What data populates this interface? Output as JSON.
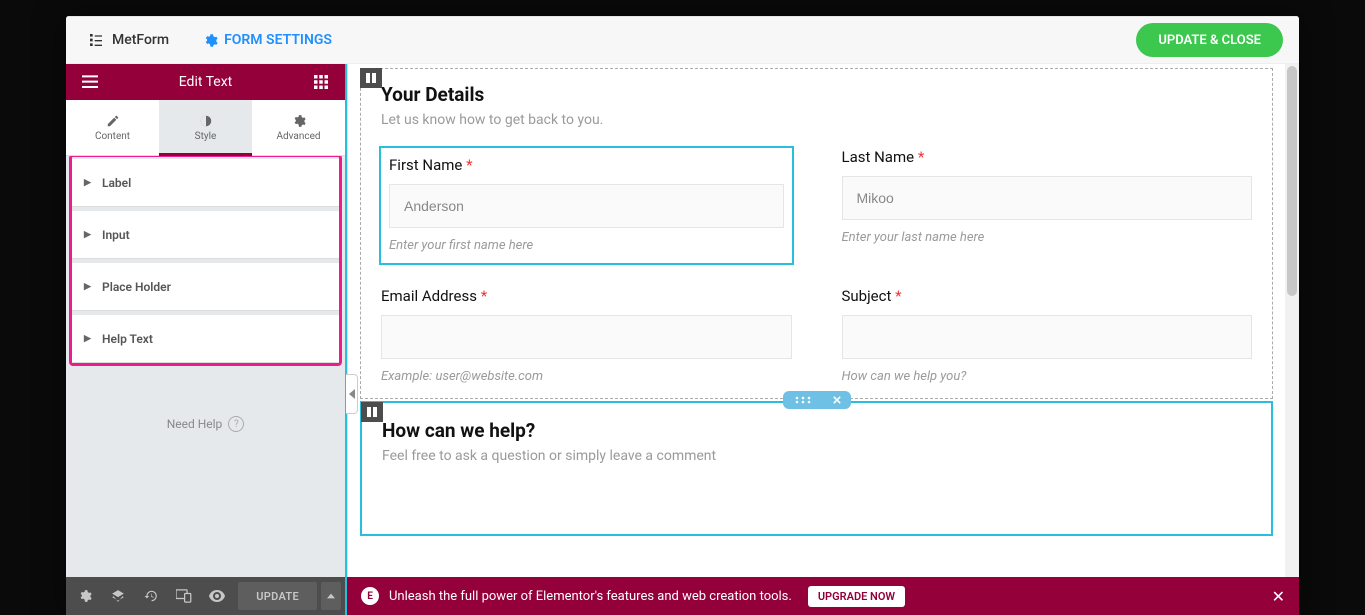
{
  "modal": {
    "brand_label": "MetForm",
    "form_settings_label": "FORM SETTINGS",
    "update_close_label": "UPDATE & CLOSE"
  },
  "panel": {
    "title": "Edit Text",
    "tabs": {
      "content": "Content",
      "style": "Style",
      "advanced": "Advanced"
    },
    "accordion": [
      "Label",
      "Input",
      "Place Holder",
      "Help Text"
    ],
    "need_help_label": "Need Help",
    "bottom": {
      "update_label": "UPDATE"
    }
  },
  "form": {
    "section1": {
      "heading": "Your Details",
      "sub": "Let us know how to get back to you.",
      "fields": {
        "first_name": {
          "label": "First Name",
          "placeholder": "Anderson",
          "help": "Enter your first name here"
        },
        "last_name": {
          "label": "Last Name",
          "placeholder": "Mikoo",
          "help": "Enter your last name here"
        },
        "email": {
          "label": "Email Address",
          "placeholder": "",
          "help": "Example: user@website.com"
        },
        "subject": {
          "label": "Subject",
          "placeholder": "",
          "help": "How can we help you?"
        }
      }
    },
    "section2": {
      "heading": "How can we help?",
      "sub": "Feel free to ask a question or simply leave a comment"
    }
  },
  "promo": {
    "text": "Unleash the full power of Elementor's features and web creation tools.",
    "button": "UPGRADE NOW"
  },
  "asterisk": "*"
}
